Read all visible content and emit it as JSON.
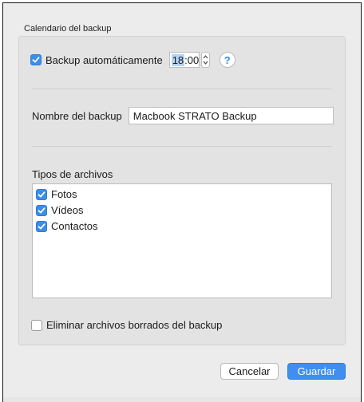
{
  "schedule": {
    "section_title": "Calendario del backup",
    "auto_backup_label": "Backup automáticamente",
    "auto_backup_checked": true,
    "time_hour": "18",
    "time_separator": ":",
    "time_minute": "00",
    "help_label": "?"
  },
  "backup_name": {
    "label": "Nombre del backup",
    "value": "Macbook STRATO Backup"
  },
  "file_types": {
    "label": "Tipos de archivos",
    "items": [
      {
        "label": "Fotos",
        "checked": true
      },
      {
        "label": "Vídeos",
        "checked": true
      },
      {
        "label": "Contactos",
        "checked": true
      }
    ]
  },
  "delete_removed": {
    "label": "Eliminar archivos borrados del backup",
    "checked": false
  },
  "buttons": {
    "cancel_label": "Cancelar",
    "save_label": "Guardar"
  },
  "colors": {
    "accent": "#3f8ef0",
    "window_background": "#ececec",
    "group_background": "#e3e3e3"
  },
  "icons": [
    "checkmark-icon",
    "stepper-icon",
    "help-icon"
  ]
}
